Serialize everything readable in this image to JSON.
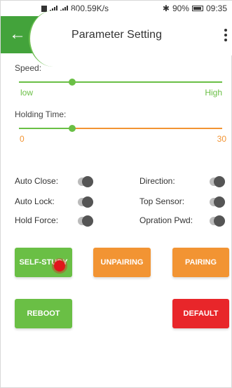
{
  "statusbar": {
    "speed": "800.59K/s",
    "battery": "90%",
    "time": "09:35",
    "bluetooth_icon": "bluetooth-icon"
  },
  "header": {
    "title": "Parameter Setting",
    "back_icon": "arrow-left-icon",
    "menu_icon": "more-vertical-icon"
  },
  "speed": {
    "label": "Speed:",
    "min_label": "low",
    "max_label": "High",
    "value_fraction": 0.26
  },
  "holding_time": {
    "label": "Holding Time:",
    "min_label": "0",
    "max_label": "30",
    "value_fraction": 0.26
  },
  "toggles": {
    "auto_close": "Auto Close:",
    "direction": "Direction:",
    "auto_lock": "Auto Lock:",
    "top_sensor": "Top Sensor:",
    "hold_force": "Hold Force:",
    "opration_pwd": "Opration Pwd:"
  },
  "buttons": {
    "self_study": "SELF-STUDY",
    "unpairing": "UNPAIRING",
    "pairing": "PAIRING",
    "reboot": "REBOOT",
    "default": "DEFAULT"
  },
  "colors": {
    "green": "#6abf45",
    "orange": "#f29433",
    "red": "#e8262a",
    "header_green": "#43a33b"
  }
}
